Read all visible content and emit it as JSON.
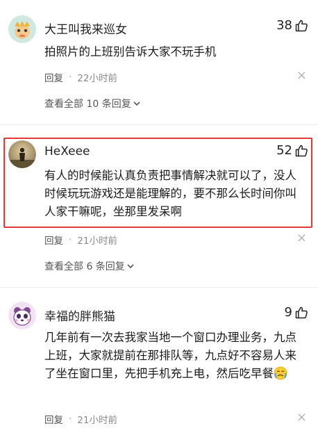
{
  "comments": [
    {
      "name": "大王叫我来巡女",
      "likes": "38",
      "text": "拍照片的上班别告诉大家不玩手机",
      "reply_label": "回复",
      "time": "22小时前",
      "view_all": "查看全部 10 条回复"
    },
    {
      "name": "HeXeee",
      "likes": "52",
      "text": "有人的时候能认真负责把事情解决就可以了，没人时候玩玩游戏还是能理解的，要不那么长时间你叫人家干嘛呢，坐那里发呆啊",
      "reply_label": "回复",
      "time": "21小时前",
      "view_all": "查看全部 6 条回复"
    },
    {
      "name": "幸福的胖熊猫",
      "likes": "9",
      "text": "几年前有一次去我家当地一个窗口办理业务，九点上班，大家就提前在那排队等，九点好不容易人来了坐在窗口里，先把手机充上电，然后吃早餐",
      "reply_label": "回复",
      "time": "21小时前"
    }
  ],
  "separator_dot": "·",
  "close_glyph": "×",
  "colors": {
    "highlight": "#e53935",
    "meta": "#8a8a8a"
  },
  "icons": {
    "like": "thumbs-up-icon",
    "close": "close-icon",
    "expand": "chevron-down-icon"
  }
}
